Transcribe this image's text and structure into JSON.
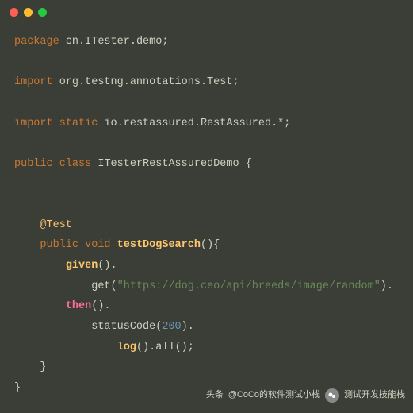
{
  "code": {
    "package_kw": "package",
    "package_name": "cn.ITester.demo",
    "import_kw": "import",
    "import1": "org.testng.annotations.Test",
    "static_kw": "static",
    "import2": "io.restassured.RestAssured.*",
    "public_kw": "public",
    "class_kw": "class",
    "class_name": "ITesterRestAssuredDemo",
    "annotation": "@Test",
    "void_kw": "void",
    "method_name": "testDogSearch",
    "given_call": "given",
    "get_call": "get",
    "url_string": "\"https://dog.ceo/api/breeds/image/random\"",
    "then_call": "then",
    "statusCode_call": "statusCode",
    "status_num": "200",
    "log_call": "log",
    "all_call": "all"
  },
  "footer": {
    "prefix": "头条",
    "at": "@CoCo的软件测试小栈",
    "label2": "测试开发技能栈"
  }
}
